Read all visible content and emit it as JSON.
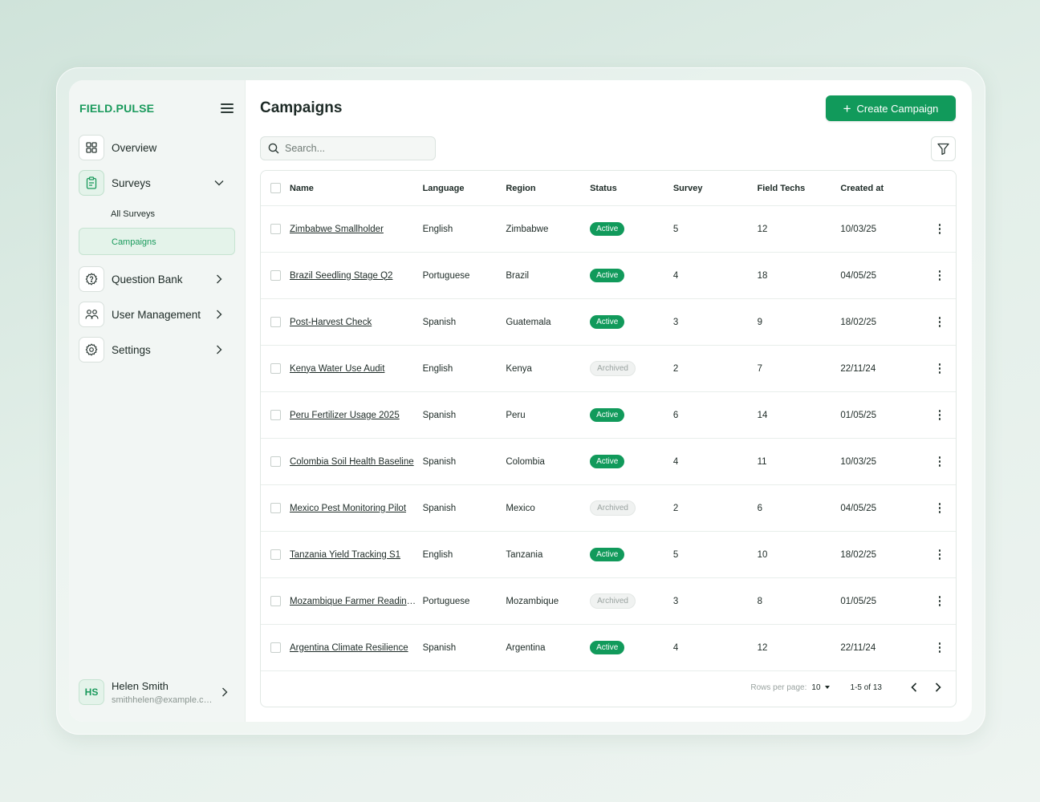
{
  "brand": "FIELD.PULSE",
  "colors": {
    "accent": "#119a5b",
    "brand": "#1a9a5c",
    "archived": "#9aa3a0"
  },
  "sidebar": {
    "items": [
      {
        "label": "Overview",
        "icon": "grid-icon"
      },
      {
        "label": "Surveys",
        "icon": "clipboard-icon",
        "expanded": true,
        "children": [
          {
            "label": "All Surveys"
          },
          {
            "label": "Campaigns",
            "selected": true
          }
        ]
      },
      {
        "label": "Question Bank",
        "icon": "question-gear-icon"
      },
      {
        "label": "User Management",
        "icon": "users-icon"
      },
      {
        "label": "Settings",
        "icon": "gear-icon"
      }
    ],
    "user": {
      "initials": "HS",
      "name": "Helen Smith",
      "email": "smithhelen@example.com"
    }
  },
  "header": {
    "title": "Campaigns",
    "create_label": "Create Campaign",
    "search_placeholder": "Search..."
  },
  "table": {
    "columns": [
      "Name",
      "Language",
      "Region",
      "Status",
      "Survey",
      "Field Techs",
      "Created at"
    ],
    "rows": [
      {
        "name": "Zimbabwe Smallholder",
        "language": "English",
        "region": "Zimbabwe",
        "status": "Active",
        "survey": "5",
        "techs": "12",
        "created": "10/03/25"
      },
      {
        "name": "Brazil Seedling Stage Q2",
        "language": "Portuguese",
        "region": "Brazil",
        "status": "Active",
        "survey": "4",
        "techs": "18",
        "created": "04/05/25"
      },
      {
        "name": "Post-Harvest Check",
        "language": "Spanish",
        "region": "Guatemala",
        "status": "Active",
        "survey": "3",
        "techs": "9",
        "created": "18/02/25"
      },
      {
        "name": "Kenya Water Use Audit",
        "language": "English",
        "region": "Kenya",
        "status": "Archived",
        "survey": "2",
        "techs": "7",
        "created": "22/11/24"
      },
      {
        "name": "Peru Fertilizer Usage 2025",
        "language": "Spanish",
        "region": "Peru",
        "status": "Active",
        "survey": "6",
        "techs": "14",
        "created": "01/05/25"
      },
      {
        "name": "Colombia Soil Health Baseline",
        "language": "Spanish",
        "region": "Colombia",
        "status": "Active",
        "survey": "4",
        "techs": "11",
        "created": "10/03/25"
      },
      {
        "name": "Mexico Pest Monitoring Pilot",
        "language": "Spanish",
        "region": "Mexico",
        "status": "Archived",
        "survey": "2",
        "techs": "6",
        "created": "04/05/25"
      },
      {
        "name": "Tanzania Yield Tracking S1",
        "language": "English",
        "region": "Tanzania",
        "status": "Active",
        "survey": "5",
        "techs": "10",
        "created": "18/02/25"
      },
      {
        "name": "Mozambique Farmer Readiness",
        "language": "Portuguese",
        "region": "Mozambique",
        "status": "Archived",
        "survey": "3",
        "techs": "8",
        "created": "01/05/25"
      },
      {
        "name": "Argentina Climate Resilience",
        "language": "Spanish",
        "region": "Argentina",
        "status": "Active",
        "survey": "4",
        "techs": "12",
        "created": "22/11/24"
      }
    ]
  },
  "pagination": {
    "rows_per_page_label": "Rows per page:",
    "rows_per_page": "10",
    "range": "1-5 of 13"
  }
}
